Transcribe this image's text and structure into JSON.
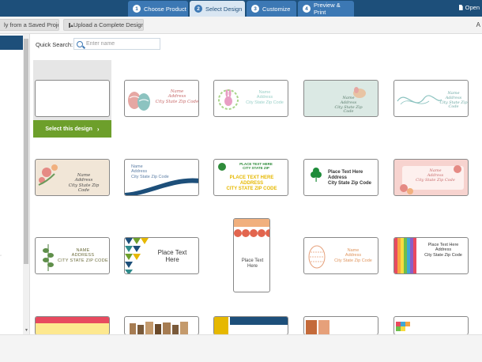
{
  "steps": [
    {
      "num": "1",
      "label": "Choose Product"
    },
    {
      "num": "2",
      "label": "Select Design"
    },
    {
      "num": "3",
      "label": "Customize"
    },
    {
      "num": "4",
      "label": "Preview & Print"
    }
  ],
  "open_label": "Open",
  "subbar": {
    "saved": "ly from a Saved Project",
    "upload": "Upload a Complete Design",
    "right_char": "A"
  },
  "search": {
    "label": "Quick Search:",
    "placeholder": "Enter name"
  },
  "select_button": "Select this design",
  "colors": {
    "topbar": "#1d4f7a",
    "tab": "#3c78b4",
    "active_tab": "#d9e6f2",
    "select_green": "#6d9f2b"
  },
  "labels": {
    "l2": {
      "name": "Name",
      "address": "Address",
      "csz": "City State Zip Code"
    },
    "l3": {
      "name": "Name",
      "address": "Address",
      "csz": "City State Zip Code"
    },
    "l4": {
      "name": "Name",
      "address": "Address",
      "csz": "City State Zip Code"
    },
    "l5": {
      "name": "Name",
      "address": "Address",
      "csz": "City State Zip Code"
    },
    "l6": {
      "name": "Name",
      "address": "Address",
      "csz": "City State Zip Code"
    },
    "l7": {
      "name": "Name",
      "address": "Address",
      "csz": "City State Zip Code"
    },
    "l8": {
      "line1": "PLACE TEXT HERE",
      "line2": "CITY STATE ZIP",
      "line3": "PLACE TEXT HERE",
      "line4": "ADDRESS",
      "line5": "CITY STATE ZIP CODE"
    },
    "l9": {
      "line1": "Place Text Here",
      "line2": "Address",
      "line3": "City State Zip Code"
    },
    "l10": {
      "name": "Name",
      "address": "Address",
      "csz": "City State Zip Code"
    },
    "l11": {
      "name": "NAME",
      "address": "ADDRESS",
      "csz": "CITY STATE ZIP CODE"
    },
    "l12": {
      "line1": "Place Text",
      "line2": "Here"
    },
    "l13": {
      "line1": "Place Text",
      "line2": "Here"
    },
    "l14": {
      "name": "Name",
      "address": "Address",
      "csz": "City State Zip Code"
    },
    "l15": {
      "line1": "Place Text Here",
      "line2": "Address",
      "line3": "City State Zip Code"
    }
  }
}
